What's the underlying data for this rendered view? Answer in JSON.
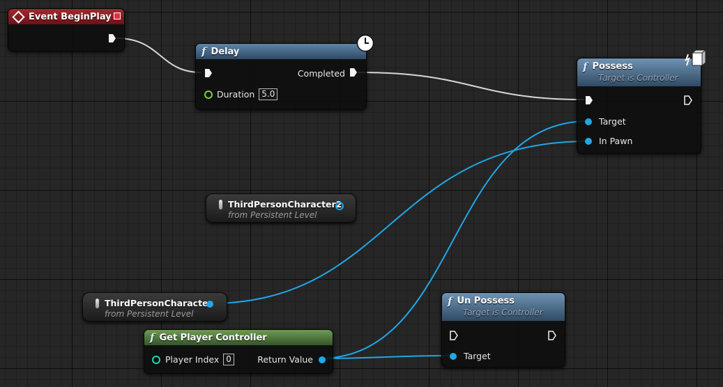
{
  "event_node": {
    "title": "Event BeginPlay"
  },
  "delay_node": {
    "title": "Delay",
    "completed_label": "Completed",
    "duration_label": "Duration",
    "duration_value": "5.0"
  },
  "possess_node": {
    "title": "Possess",
    "subtitle": "Target is Controller",
    "target_label": "Target",
    "pawn_label": "In Pawn"
  },
  "var_node_2": {
    "title": "ThirdPersonCharacter2",
    "subtitle": "from Persistent Level"
  },
  "var_node_1": {
    "title": "ThirdPersonCharacter",
    "subtitle": "from Persistent Level"
  },
  "gpc_node": {
    "title": "Get Player Controller",
    "index_label": "Player Index",
    "index_value": "0",
    "return_label": "Return Value"
  },
  "unpossess_node": {
    "title": "Un Possess",
    "subtitle": "Target is Controller",
    "target_label": "Target"
  },
  "colors": {
    "event_header": "#8a1c22",
    "function_header": "#4b6f91",
    "pure_function_header": "#4f7a3a",
    "exec_wire": "#d8d8d8",
    "object_wire": "#1fa8e8"
  },
  "icons": {
    "event": "diamond-icon",
    "function": "function-f-icon",
    "latent": "clock-icon",
    "network": "server-authority-icon",
    "actor": "actor-pill-icon"
  }
}
